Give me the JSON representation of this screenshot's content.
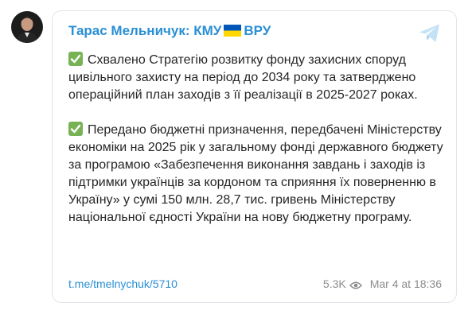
{
  "channel": {
    "name_prefix": "Тарас Мельничук: КМУ",
    "name_suffix": "ВРУ",
    "flag_icon": "ukraine-flag-icon"
  },
  "post": {
    "paragraphs": [
      "Схвалено Стратегію розвитку фонду захисних споруд цивільного захисту на період до 2034 року та затверджено операційний план заходів з її реалізації в 2025-2027 роках.",
      "Передано бюджетні призначення, передбачені Міністерству економіки на 2025 рік у загальному фонді державного бюджету за програмою «Забезпечення виконання завдань і заходів із підтримки українців за кордоном та сприяння їх поверненню в Україну» у сумі 150 млн. 28,7 тис. гривень Міністерству національної єдності України на нову бюджетну програму."
    ],
    "link": "t.me/tmelnychuk/5710",
    "views": "5.3K",
    "date": "Mar 4 at 18:36"
  },
  "colors": {
    "accent": "#2a8fd4",
    "check": "#77b255",
    "meta": "#8c8c8c"
  }
}
